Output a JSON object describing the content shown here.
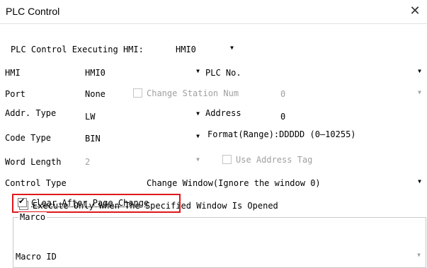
{
  "window": {
    "title": "PLC Control",
    "close_glyph": "✕"
  },
  "plc_control_executing_hmi": {
    "label": "PLC Control Executing HMI:",
    "value": "HMI0"
  },
  "hmi": {
    "label": "HMI",
    "value": "HMI0"
  },
  "plc_no": {
    "label": "PLC No.",
    "value": ""
  },
  "port": {
    "label": "Port",
    "value": "None"
  },
  "change_station_num": {
    "label": "Change Station Num",
    "checked": false,
    "value": "0"
  },
  "addr_type": {
    "label": "Addr. Type",
    "value": "LW"
  },
  "address": {
    "label": "Address",
    "value": "0"
  },
  "code_type": {
    "label": "Code Type",
    "value": "BIN"
  },
  "format_range": {
    "text": "Format(Range):DDDDD (0—10255)"
  },
  "word_length": {
    "label": "Word Length",
    "value": "2"
  },
  "use_address_tag": {
    "label": "Use Address Tag",
    "checked": false
  },
  "control_type": {
    "label": "Control Type",
    "value": "Change Window(Ignore the window 0)"
  },
  "execute_only": {
    "label": "Execute Only When The Specified Window Is Opened",
    "checked": false
  },
  "clear_after_page_change": {
    "label": "Clear After Page Change",
    "checked": true
  },
  "marco": {
    "group_title": "Marco",
    "macro_id_label": "Macro ID",
    "macro_id_value": ""
  },
  "icons": {
    "dropdown": "▼"
  },
  "colors": {
    "highlight": "#e0161b",
    "disabled_text": "#a0a0a0"
  }
}
